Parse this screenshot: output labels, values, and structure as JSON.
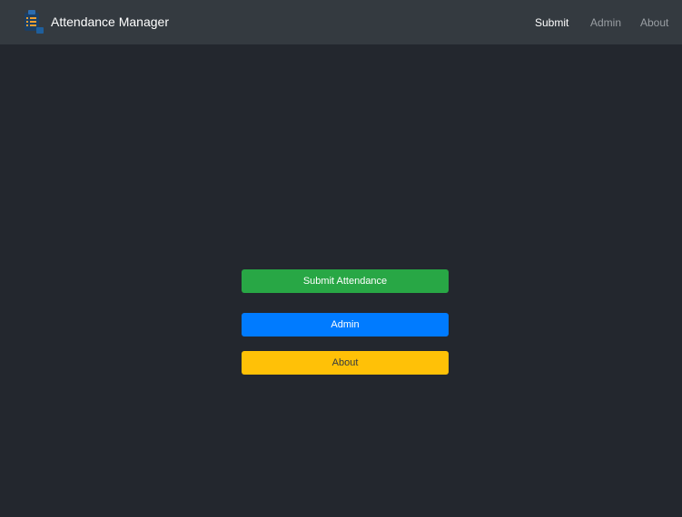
{
  "app": {
    "title": "Attendance Manager",
    "logo_icon": "clipboard-list-icon"
  },
  "nav": {
    "links": [
      {
        "label": "Submit",
        "active": true
      },
      {
        "label": "Admin",
        "active": false
      },
      {
        "label": "About",
        "active": false
      }
    ]
  },
  "main": {
    "buttons": [
      {
        "label": "Submit Attendance",
        "color": "#28a745"
      },
      {
        "label": "Admin",
        "color": "#007bff"
      },
      {
        "label": "About",
        "color": "#ffc107"
      }
    ]
  },
  "colors": {
    "background": "#23272e",
    "navbar": "#343a40",
    "nav_active": "#ffffff",
    "nav_inactive": "#9a9fa4"
  }
}
